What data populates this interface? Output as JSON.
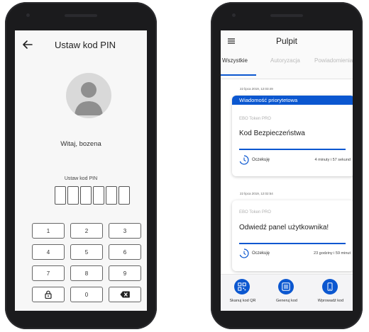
{
  "pin_screen": {
    "title": "Ustaw kod PIN",
    "back_icon": "arrow-left-icon",
    "avatar_icon": "user-avatar-icon",
    "greeting": "Witaj, bozena",
    "pin_label": "Ustaw kod PIN",
    "pin_box_count": 6,
    "keypad": [
      "1",
      "2",
      "3",
      "4",
      "5",
      "6",
      "7",
      "8",
      "9",
      "",
      "0",
      ""
    ],
    "keypad_icons": {
      "lock": "lock-icon",
      "backspace": "backspace-icon"
    }
  },
  "dashboard": {
    "title": "Pulpit",
    "menu_icon": "hamburger-menu-icon",
    "tabs": [
      {
        "label": "Wszystkie",
        "active": true
      },
      {
        "label": "Autoryzacja",
        "active": false
      },
      {
        "label": "Powiadomienia",
        "active": false
      }
    ],
    "notifications": [
      {
        "timestamp": "22 lipca 2019, 12:03:49",
        "priority_label": "Wiadomość priorytetowa",
        "source": "EBO Token PRO",
        "title": "Kod Bezpieczeństwa",
        "status": "Oczekuję",
        "eta": "4 minuty i 57 sekund"
      },
      {
        "timestamp": "22 lipca 2019, 12:02:54",
        "source": "EBO Token PRO",
        "title": "Odwiedź panel użytkownika!",
        "status": "Oczekuję",
        "eta": "23 godziny i 59 minut"
      }
    ],
    "bottom_nav": [
      {
        "label": "Skanuj kod QR",
        "icon": "qr-code-icon"
      },
      {
        "label": "Generuj kod",
        "icon": "keypad-icon"
      },
      {
        "label": "Wprowadź kod",
        "icon": "phone-icon"
      }
    ]
  },
  "colors": {
    "accent": "#0b57d0",
    "frame": "#1b1b1d"
  }
}
